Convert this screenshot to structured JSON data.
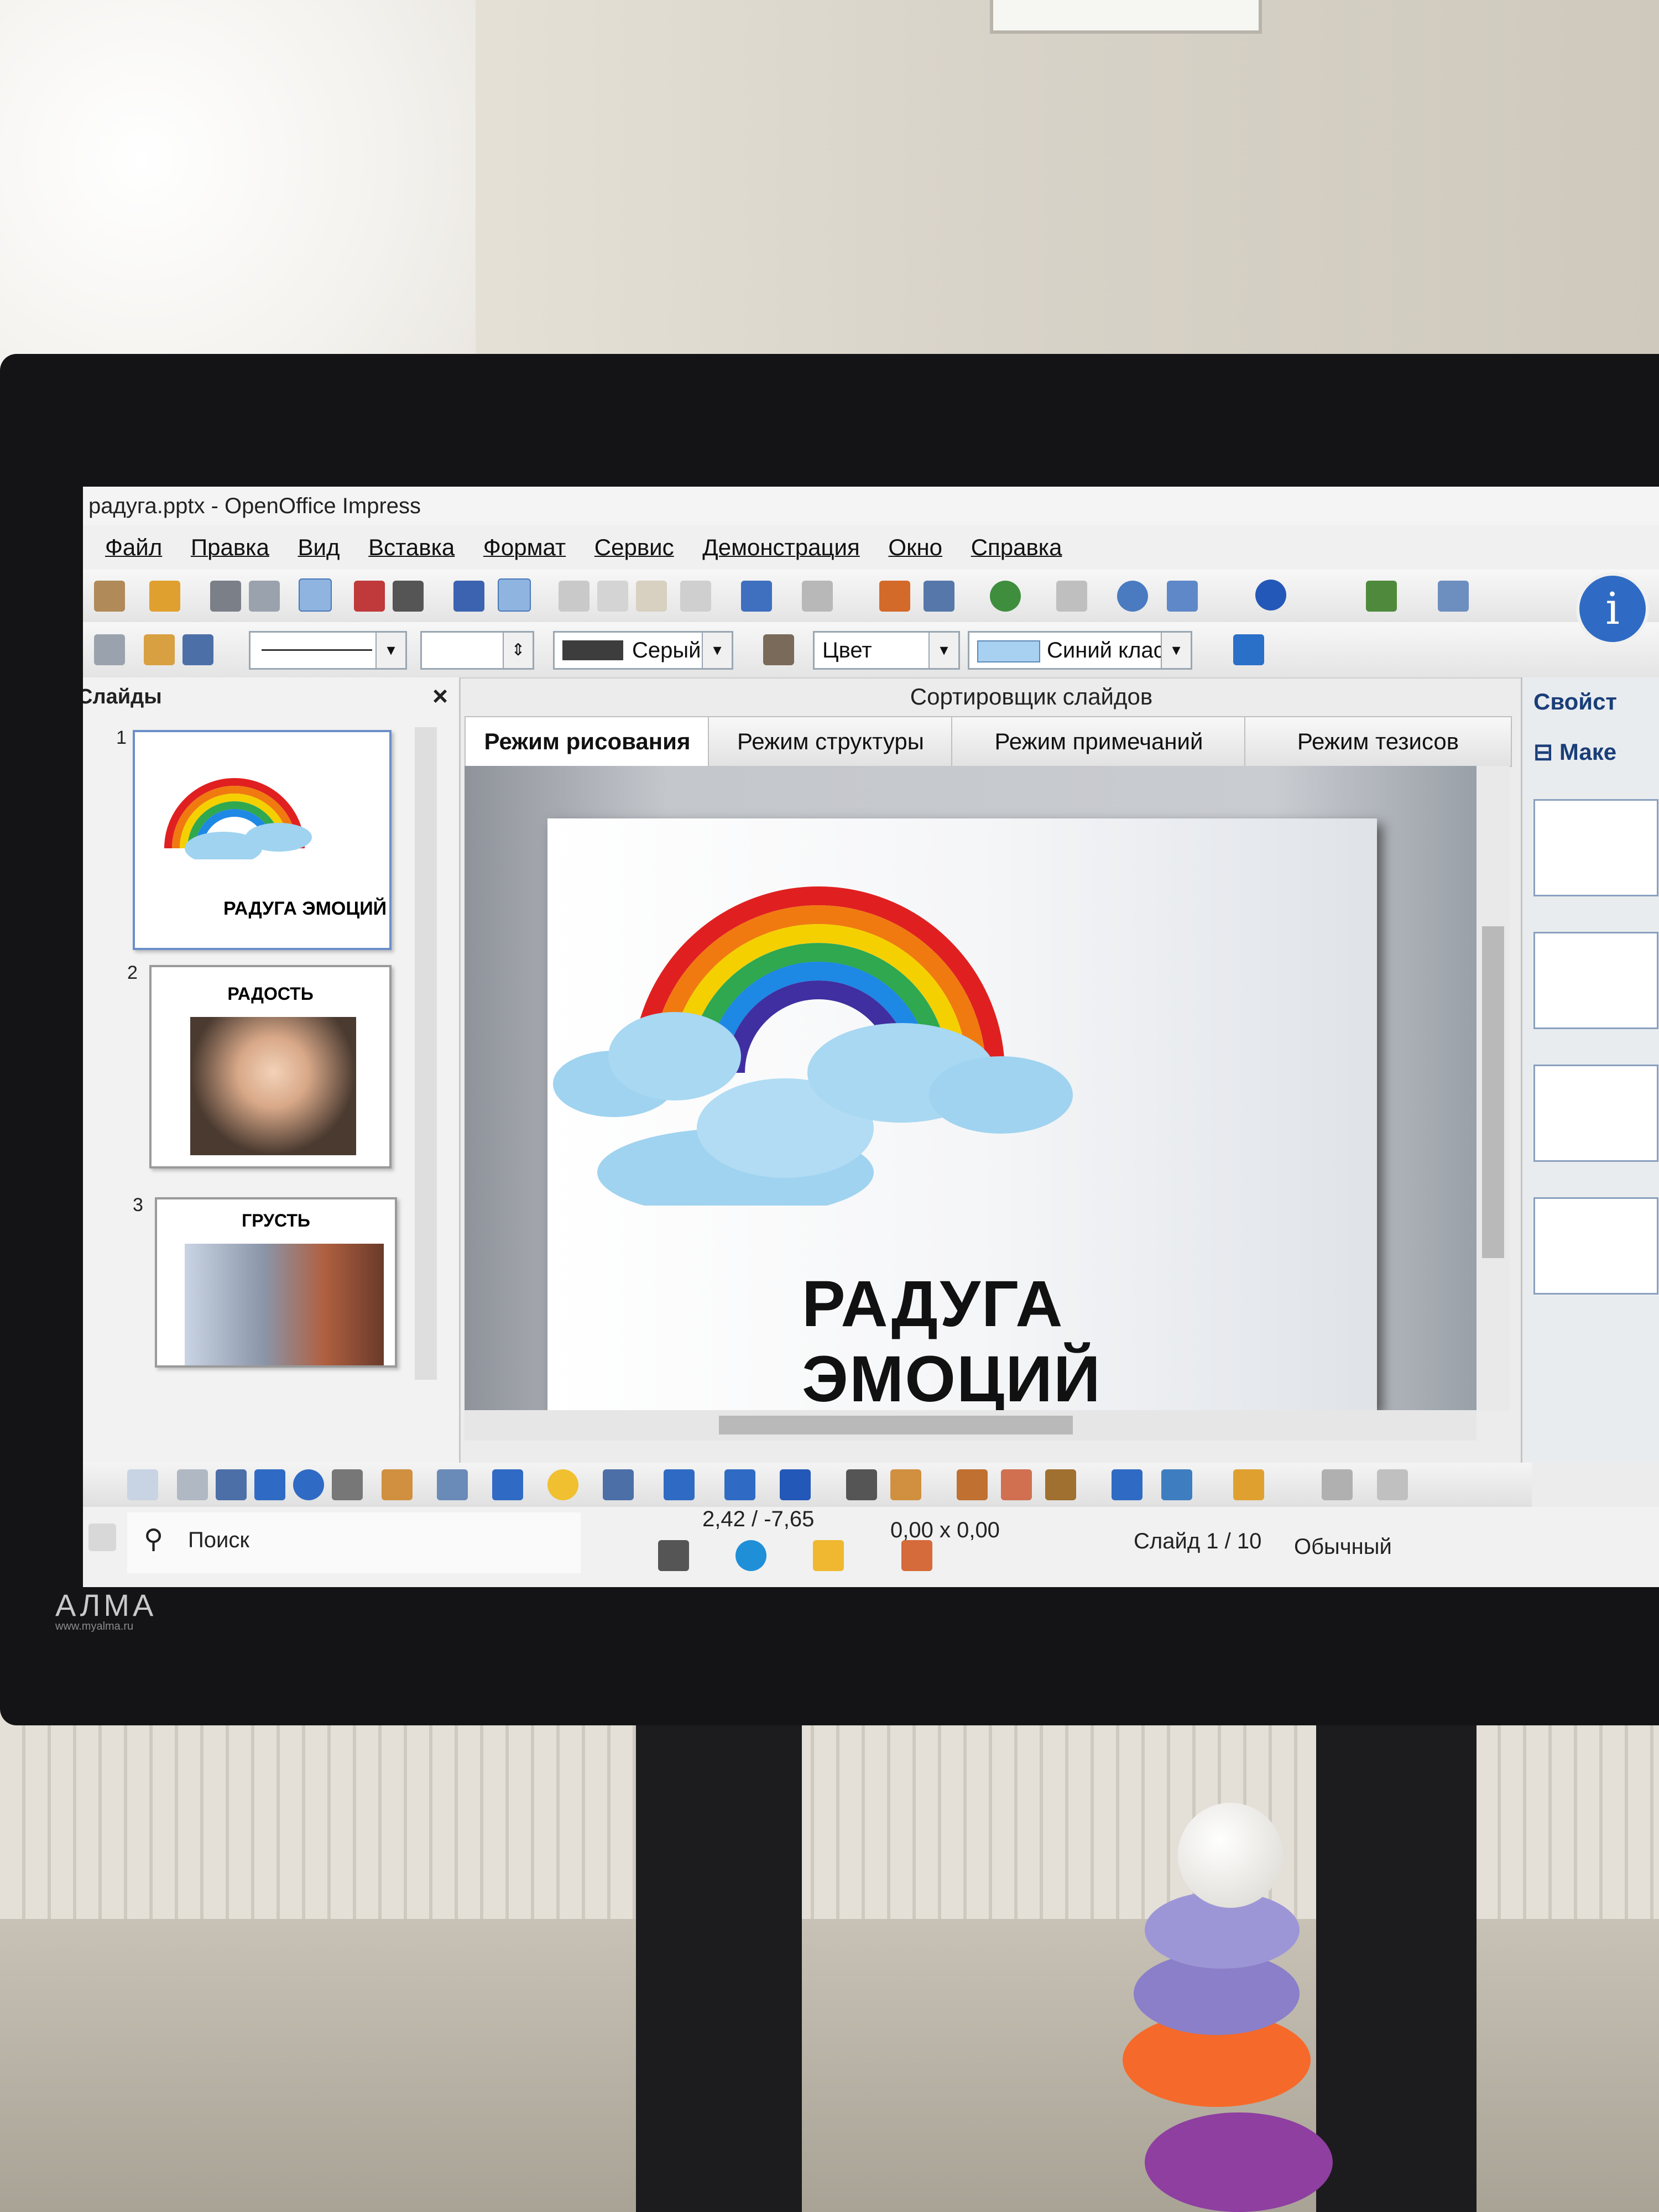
{
  "window": {
    "title": "радуга.pptx - OpenOffice Impress",
    "menu": [
      "Файл",
      "Правка",
      "Вид",
      "Вставка",
      "Формат",
      "Сервис",
      "Демонстрация",
      "Окно",
      "Справка"
    ]
  },
  "toolbar": {
    "line_color": "Серый",
    "fill_mode": "Цвет",
    "fill_color": "Синий клас"
  },
  "slides_panel": {
    "title": "Слайды",
    "close": "×",
    "items": [
      {
        "number": "1",
        "caption": "РАДУГА ЭМОЦИЙ"
      },
      {
        "number": "2",
        "caption": "РАДОСТЬ"
      },
      {
        "number": "3",
        "caption": "ГРУСТЬ"
      }
    ]
  },
  "view_tabs": {
    "header": "Сортировщик слайдов",
    "tabs": [
      "Режим рисования",
      "Режим структуры",
      "Режим примечаний",
      "Режим тезисов"
    ],
    "active": "Режим рисования"
  },
  "slide": {
    "title": "РАДУГА ЭМОЦИЙ"
  },
  "properties_panel": {
    "title": "Свойст",
    "section": "Маке"
  },
  "statusbar": {
    "position": "2,42 / -7,65",
    "size": "0,00 x 0,00",
    "slide": "Слайд 1 / 10",
    "layout": "Обычный"
  },
  "taskbar": {
    "search_placeholder": "Поиск"
  },
  "monitor": {
    "brand": "АЛМА",
    "site": "www.myalma.ru"
  },
  "colors": {
    "rainbow": [
      "#e02020",
      "#f07a10",
      "#f5d000",
      "#2fa84f",
      "#1e88e5",
      "#3f2fa0",
      "#7b2a9a"
    ],
    "cloud": "#9fd3f0",
    "accent_blue": "#1f5fb8"
  }
}
